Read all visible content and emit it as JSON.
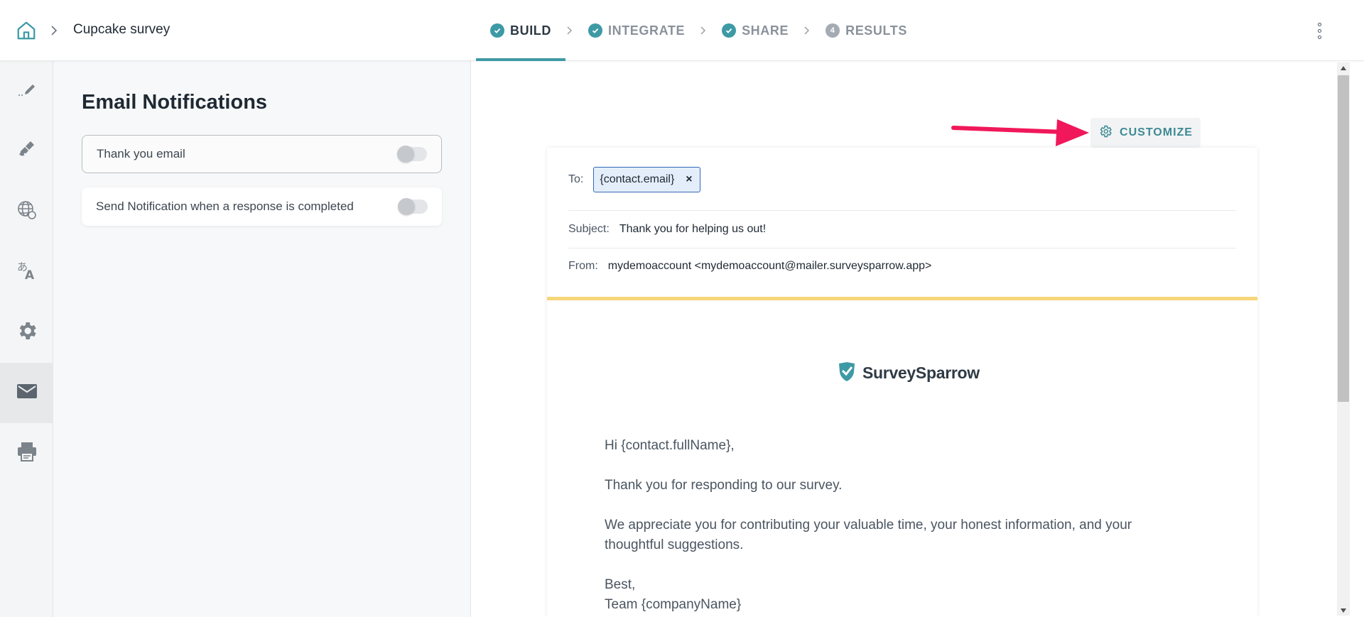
{
  "header": {
    "survey_name": "Cupcake survey",
    "steps": [
      {
        "label": "BUILD",
        "state": "done",
        "active": true
      },
      {
        "label": "INTEGRATE",
        "state": "done"
      },
      {
        "label": "SHARE",
        "state": "done"
      },
      {
        "label": "RESULTS",
        "state": "pending",
        "number": "4"
      }
    ]
  },
  "rail": {
    "items": [
      "pen-icon",
      "paint-brush-icon",
      "globe-icon",
      "translate-icon",
      "gear-icon",
      "mail-icon",
      "printer-icon"
    ],
    "active": "mail-icon"
  },
  "panel": {
    "title": "Email Notifications",
    "toggles": [
      {
        "label": "Thank you email",
        "on": false
      },
      {
        "label": "Send Notification when a response is completed",
        "on": false
      }
    ]
  },
  "preview": {
    "customize_label": "CUSTOMIZE",
    "to_label": "To:",
    "to_chip": "{contact.email}",
    "chip_remove": "×",
    "subject_label": "Subject:",
    "subject_value": "Thank you for helping us out!",
    "from_label": "From:",
    "from_value": "mydemoaccount <mydemoaccount@mailer.surveysparrow.app>",
    "logo_text": "SurveySparrow",
    "body": {
      "greeting": "Hi {contact.fullName},",
      "line1": "Thank you for responding to our survey.",
      "line2a": "We appreciate you for contributing your valuable time, your honest information, and your",
      "line2b": "thoughtful suggestions.",
      "signoff": "Best,",
      "signature": "Team {companyName}"
    }
  },
  "colors": {
    "accent": "#3d9aa5",
    "arrow": "#f0185a",
    "yellow_rule": "#f6d67a"
  }
}
